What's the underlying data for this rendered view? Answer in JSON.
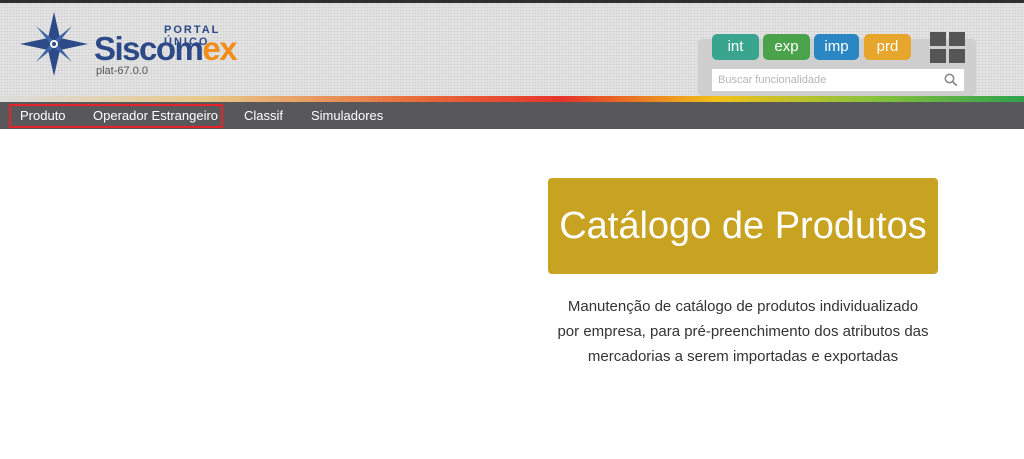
{
  "header": {
    "portal_label": "PORTAL ÚNICO",
    "brand_part1": "Siscom",
    "brand_part2": "ex",
    "version": "plat-67.0.0",
    "environments": [
      {
        "label": "int",
        "color": "#3aa58e"
      },
      {
        "label": "exp",
        "color": "#4aa34b"
      },
      {
        "label": "imp",
        "color": "#2b87c4"
      },
      {
        "label": "prd",
        "color": "#e6a52b"
      }
    ],
    "apps_icon": "grid-icon",
    "search": {
      "placeholder": "Buscar funcionalidade",
      "icon": "search-icon"
    }
  },
  "nav": {
    "items": [
      "Produto",
      "Operador Estrangeiro",
      "Classif",
      "Simuladores"
    ]
  },
  "main": {
    "catalog_title": "Catálogo de Produtos",
    "description_lines": [
      "Manutenção de catálogo de produtos individualizado",
      "por empresa, para pré-preenchimento dos atributos das",
      "mercadorias a serem importadas e exportadas"
    ]
  },
  "colors": {
    "brand_blue": "#2b4a87",
    "brand_orange": "#f28c1a",
    "navbar": "#58585a",
    "catalog_card": "#c8a221",
    "highlight": "#e5232a"
  }
}
